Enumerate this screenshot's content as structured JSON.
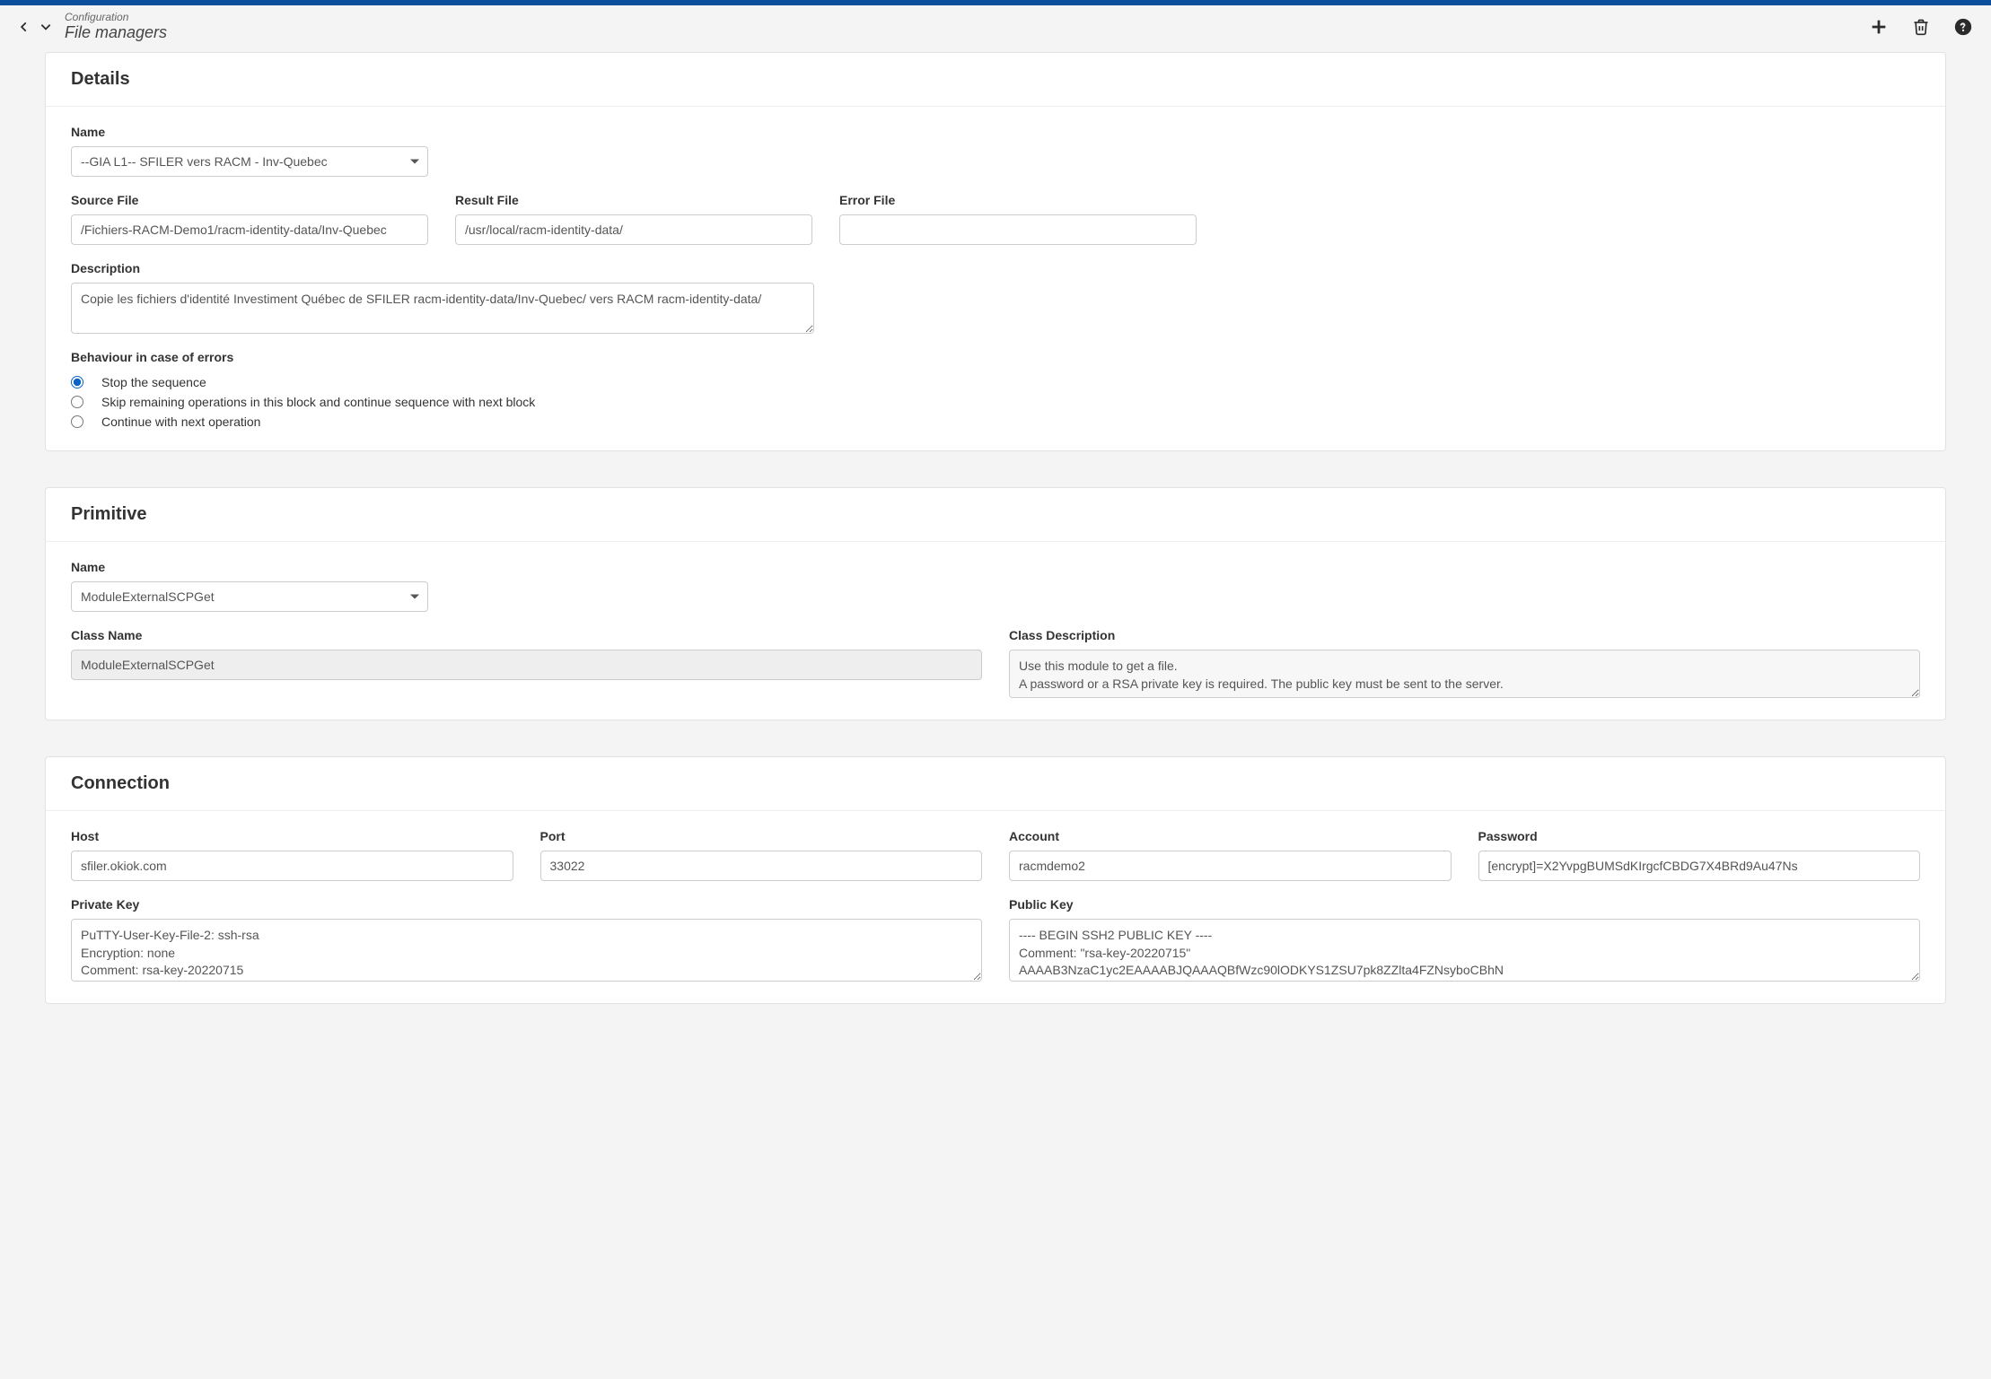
{
  "header": {
    "breadcrumb": "Configuration",
    "title": "File managers"
  },
  "details": {
    "panel_title": "Details",
    "name_label": "Name",
    "name_value": "--GIA L1-- SFILER vers RACM - Inv-Quebec",
    "source_label": "Source File",
    "source_value": "/Fichiers-RACM-Demo1/racm-identity-data/Inv-Quebec",
    "result_label": "Result File",
    "result_value": "/usr/local/racm-identity-data/",
    "error_label": "Error File",
    "error_value": "",
    "description_label": "Description",
    "description_value": "Copie les fichiers d'identité Investiment Québec de SFILER racm-identity-data/Inv-Quebec/ vers RACM racm-identity-data/",
    "behaviour_label": "Behaviour in case of errors",
    "behaviour_options": {
      "stop": "Stop the sequence",
      "skip": "Skip remaining operations in this block and continue sequence with next block",
      "continue": "Continue with next operation"
    }
  },
  "primitive": {
    "panel_title": "Primitive",
    "name_label": "Name",
    "name_value": "ModuleExternalSCPGet",
    "class_name_label": "Class Name",
    "class_name_value": "ModuleExternalSCPGet",
    "class_desc_label": "Class Description",
    "class_desc_value": "Use this module to get a file.\nA password or a RSA private key is required. The public key must be sent to the server."
  },
  "connection": {
    "panel_title": "Connection",
    "host_label": "Host",
    "host_value": "sfiler.okiok.com",
    "port_label": "Port",
    "port_value": "33022",
    "account_label": "Account",
    "account_value": "racmdemo2",
    "password_label": "Password",
    "password_value": "[encrypt]=X2YvpgBUMSdKIrgcfCBDG7X4BRd9Au47Ns",
    "private_key_label": "Private Key",
    "private_key_value": "PuTTY-User-Key-File-2: ssh-rsa\nEncryption: none\nComment: rsa-key-20220715",
    "public_key_label": "Public Key",
    "public_key_value": "---- BEGIN SSH2 PUBLIC KEY ----\nComment: \"rsa-key-20220715\"\nAAAAB3NzaC1yc2EAAAABJQAAAQBfWzc90lODKYS1ZSU7pk8ZZlta4FZNsyboCBhN"
  }
}
